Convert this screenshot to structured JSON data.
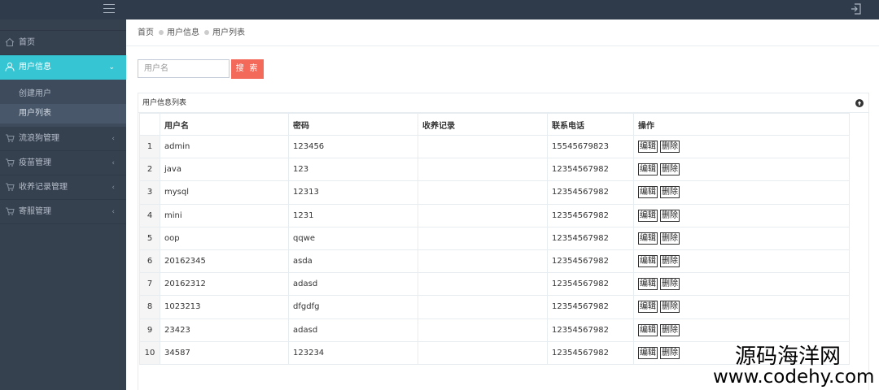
{
  "header": {
    "menu_icon": "hamburger-icon",
    "logout_icon": "logout-icon"
  },
  "sidebar": {
    "items": [
      {
        "label": "首页",
        "icon": "home-icon"
      },
      {
        "label": "用户信息",
        "icon": "user-icon",
        "active": true,
        "children": [
          {
            "label": "创建用户"
          },
          {
            "label": "用户列表",
            "current": true
          }
        ]
      },
      {
        "label": "流浪狗管理",
        "icon": "cart-icon"
      },
      {
        "label": "疫苗管理",
        "icon": "cart-icon"
      },
      {
        "label": "收养记录管理",
        "icon": "cart-icon"
      },
      {
        "label": "寄服管理",
        "icon": "cart-icon"
      }
    ]
  },
  "breadcrumb": [
    "首页",
    "用户信息",
    "用户列表"
  ],
  "search": {
    "placeholder": "用户名",
    "value": "",
    "button": "搜 索"
  },
  "panel": {
    "title": "用户信息列表"
  },
  "table": {
    "columns": [
      "用户名",
      "密码",
      "收养记录",
      "联系电话",
      "操作"
    ],
    "rows": [
      {
        "no": "1",
        "username": "admin",
        "password": "123456",
        "record": "",
        "phone": "15545679823"
      },
      {
        "no": "2",
        "username": "java",
        "password": "123",
        "record": "",
        "phone": "12354567982"
      },
      {
        "no": "3",
        "username": "mysql",
        "password": "12313",
        "record": "",
        "phone": "12354567982"
      },
      {
        "no": "4",
        "username": "mini",
        "password": "1231",
        "record": "",
        "phone": "12354567982"
      },
      {
        "no": "5",
        "username": "oop",
        "password": "qqwe",
        "record": "",
        "phone": "12354567982"
      },
      {
        "no": "6",
        "username": "20162345",
        "password": "asda",
        "record": "",
        "phone": "12354567982"
      },
      {
        "no": "7",
        "username": "20162312",
        "password": "adasd",
        "record": "",
        "phone": "12354567982"
      },
      {
        "no": "8",
        "username": "1023213",
        "password": "dfgdfg",
        "record": "",
        "phone": "12354567982"
      },
      {
        "no": "9",
        "username": "23423",
        "password": "adasd",
        "record": "",
        "phone": "12354567982"
      },
      {
        "no": "10",
        "username": "34587",
        "password": "123234",
        "record": "",
        "phone": "12354567982"
      }
    ],
    "edit_label": "编辑",
    "delete_label": "删除"
  },
  "watermark": {
    "line1": "源码海洋网",
    "line2": "www.codehy.com"
  }
}
